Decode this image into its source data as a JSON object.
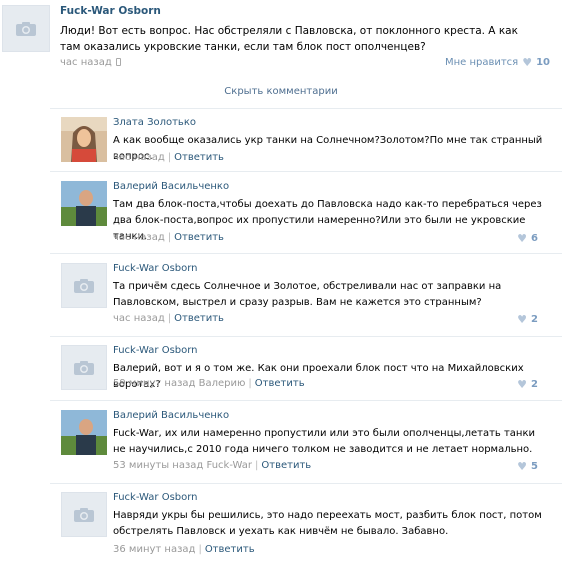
{
  "post": {
    "author": "Fuck-War Osborn",
    "text": "Люди! Вот есть вопрос. Нас обстреляли с Павловска, от поклонного креста. А как там оказались укровские танки, если там блок пост ополченцев?",
    "time": "час назад",
    "like_label": "Мне нравится",
    "like_count": "10"
  },
  "hide_comments_label": "Скрыть комментарии",
  "comments": [
    {
      "author": "Злата Золотько",
      "text": "А как вообще оказались укр танки на Солнечном?Золотом?По мне так странный вопрос.",
      "time": "час назад",
      "reply": "Ответить",
      "likes": ""
    },
    {
      "author": "Валерий Васильченко",
      "text": "Там два блок-поста,чтобы доехать до Павловска надо как-то перебраться через два блок-поста,вопрос их пропустили намеренно?Или это были не укровские танки.",
      "time": "час назад",
      "reply": "Ответить",
      "likes": "6"
    },
    {
      "author": "Fuck-War Osborn",
      "text": "Та причём сдесь Солнечное и Золотое, обстреливали нас от заправки на Павловском, выстрел и сразу разрыв. Вам не кажется это странным?",
      "time": "час назад",
      "reply": "Ответить",
      "likes": "2"
    },
    {
      "author": "Fuck-War Osborn",
      "text": "Валерий, вот и я о том же. Как они проехали блок пост что на Михайловских воротах?",
      "time": "59 минут назад Валерию",
      "reply": "Ответить",
      "likes": "2"
    },
    {
      "author": "Валерий Васильченко",
      "text": "Fuck-War, их или намеренно пропустили или это были ополченцы,летать танки не научились,с 2010 года ничего толком не заводится и не летает нормально.",
      "time": "53 минуты назад Fuck-War",
      "reply": "Ответить",
      "likes": "5"
    },
    {
      "author": "Fuck-War Osborn",
      "text": "Навряди укры бы решились, это надо переехать мост, разбить блок пост, потом обстрелять Павловск и уехать как нивчём не бывало. Забавно.",
      "time": "36 минут назад",
      "reply": "Ответить",
      "likes": ""
    }
  ],
  "icons": {
    "camera": "camera-icon",
    "heart": "heart-icon",
    "phone": "mobile-icon"
  },
  "colors": {
    "link": "#2b587a",
    "meta": "#999999",
    "avatar_bg": "#e6ebf0"
  }
}
